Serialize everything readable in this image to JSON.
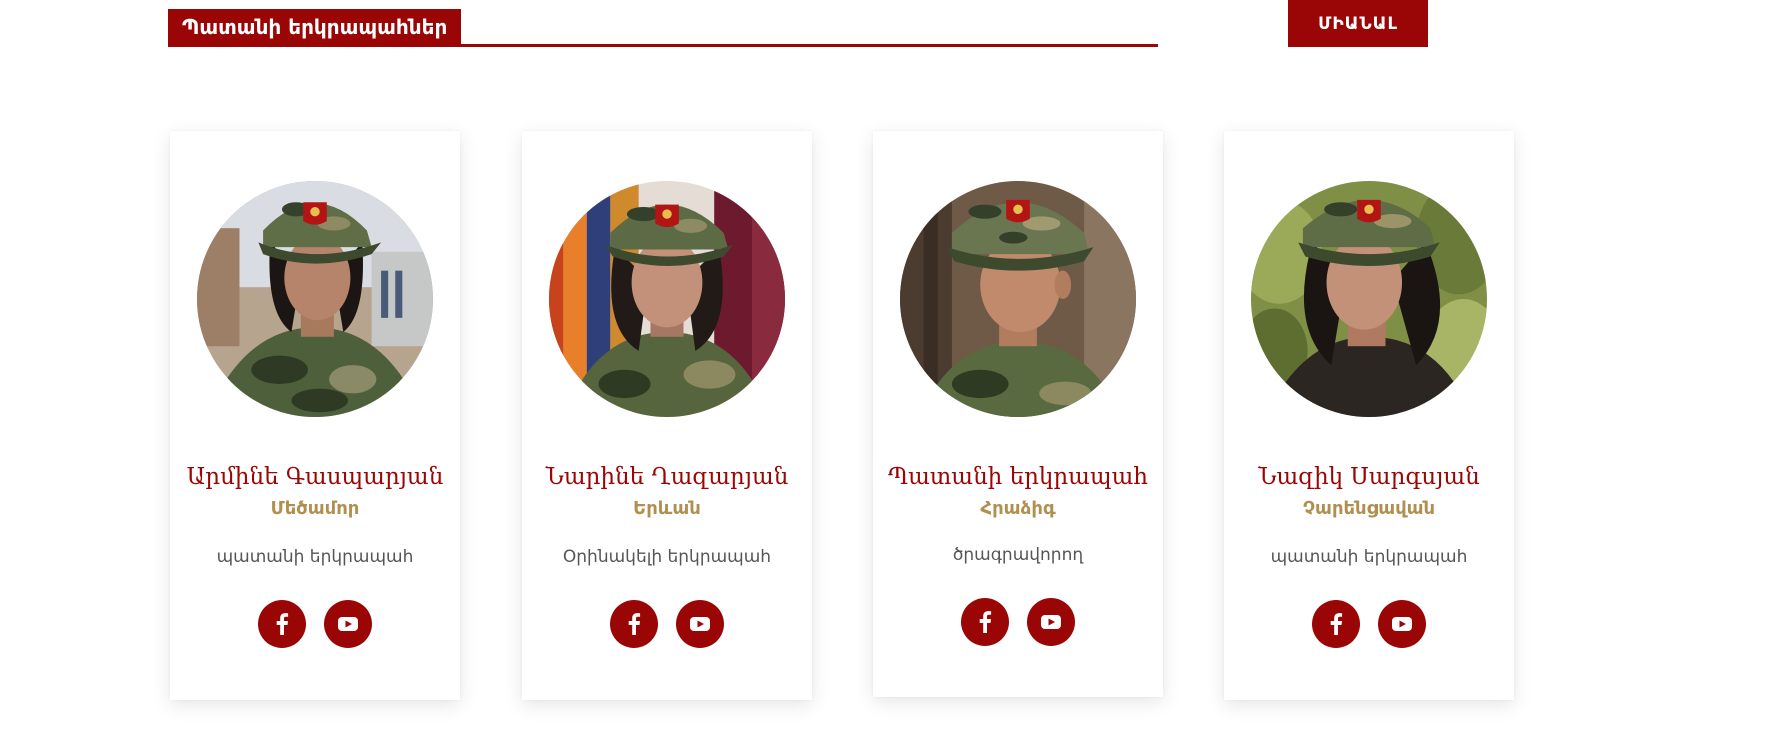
{
  "section": {
    "title": "Պատանի երկրապահներ",
    "join_label": "ՄԻԱՆԱԼ"
  },
  "colors": {
    "accent": "#9a0606",
    "location": "#b09050",
    "role": "#555555"
  },
  "cards": [
    {
      "name": "Արմինե Գասպարյան",
      "location": "Մեծամոր",
      "role": "պատանի երկրապահ",
      "photo_icon": "profile-photo",
      "social": [
        "facebook-icon",
        "youtube-icon"
      ]
    },
    {
      "name": "Նարինե Ղազարյան",
      "location": "Երևան",
      "role": "Օրինակելի երկրապահ",
      "photo_icon": "profile-photo",
      "social": [
        "facebook-icon",
        "youtube-icon"
      ]
    },
    {
      "name": "Պատանի երկրապահ",
      "location": "Հրաձիգ",
      "role": "ծրագրավորող",
      "photo_icon": "profile-photo",
      "social": [
        "facebook-icon",
        "youtube-icon"
      ]
    },
    {
      "name": "Նազիկ Սարգսյան",
      "location": "Չարենցավան",
      "role": "պատանի երկրապահ",
      "photo_icon": "profile-photo",
      "social": [
        "facebook-icon",
        "youtube-icon"
      ]
    }
  ]
}
